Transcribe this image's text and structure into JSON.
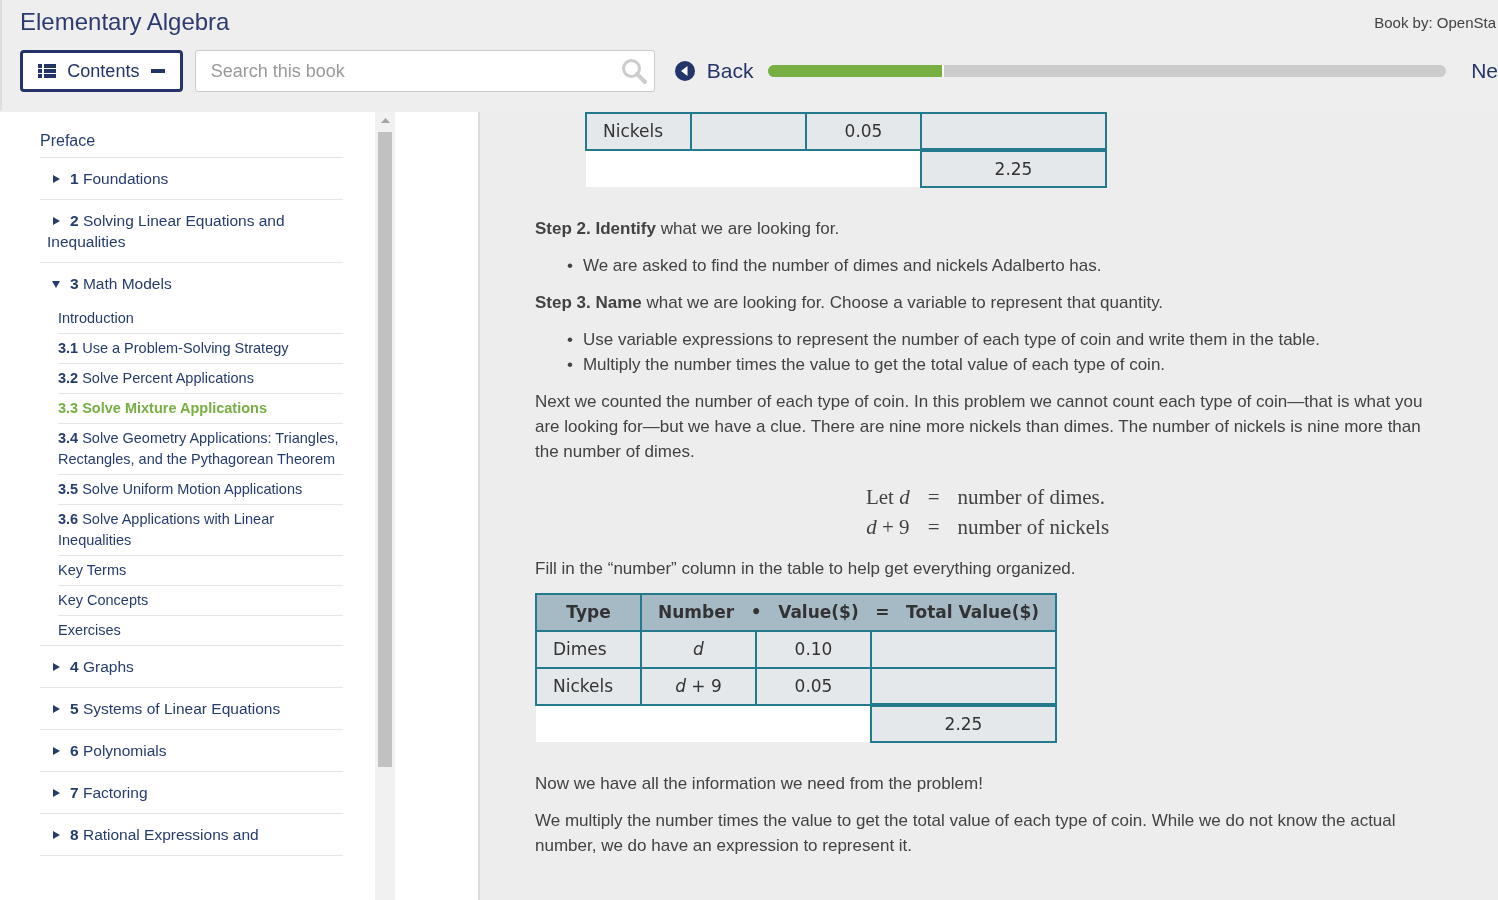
{
  "header": {
    "title": "Elementary Algebra",
    "book_by": "Book by: OpenSta",
    "contents_button": "Contents",
    "search": {
      "placeholder": "Search this book"
    },
    "back": "Back",
    "progress": {
      "level": 0.26
    },
    "next": "Ne"
  },
  "toc": [
    {
      "kind": "link",
      "title": "Preface"
    },
    {
      "kind": "chapter",
      "num": "1",
      "title": "Foundations",
      "expanded": false
    },
    {
      "kind": "chapter",
      "num": "2",
      "title": "Solving Linear Equations and Inequalities",
      "expanded": false
    },
    {
      "kind": "chapter",
      "num": "3",
      "title": "Math Models",
      "expanded": true,
      "children": [
        {
          "title": "Introduction",
          "selected": false
        },
        {
          "num": "3.1",
          "title": "Use a Problem-Solving Strategy",
          "selected": false
        },
        {
          "num": "3.2",
          "title": "Solve Percent Applications",
          "selected": false
        },
        {
          "num": "3.3",
          "title": "Solve Mixture Applications",
          "selected": true
        },
        {
          "num": "3.4",
          "title": "Solve Geometry Applications: Triangles, Rectangles, and the Pythagorean Theorem",
          "selected": false
        },
        {
          "num": "3.5",
          "title": "Solve Uniform Motion Applications",
          "selected": false
        },
        {
          "num": "3.6",
          "title": "Solve Applications with Linear Inequalities",
          "selected": false
        },
        {
          "title": "Key Terms",
          "selected": false
        },
        {
          "title": "Key Concepts",
          "selected": false
        },
        {
          "title": "Exercises",
          "selected": false
        }
      ]
    },
    {
      "kind": "chapter",
      "num": "4",
      "title": "Graphs",
      "expanded": false
    },
    {
      "kind": "chapter",
      "num": "5",
      "title": "Systems of Linear Equations",
      "expanded": false
    },
    {
      "kind": "chapter",
      "num": "6",
      "title": "Polynomials",
      "expanded": false
    },
    {
      "kind": "chapter",
      "num": "7",
      "title": "Factoring",
      "expanded": false
    },
    {
      "kind": "chapter",
      "num": "8",
      "title": "Rational Expressions and",
      "expanded": false
    }
  ],
  "content": [
    {
      "kind": "table",
      "rows": [
        [
          "Nickels",
          "",
          "0.05",
          ""
        ]
      ],
      "total": "2.25"
    },
    {
      "kind": "paragraph",
      "text": "**Step 2. Identify** what we are looking for."
    },
    {
      "kind": "bullets",
      "marker": "•",
      "items": [
        "We are asked to find the number of dimes and nickels Adalberto has."
      ]
    },
    {
      "kind": "paragraph",
      "text": "**Step 3. Name** what we are looking for. Choose a variable to represent that quantity."
    },
    {
      "kind": "bullets",
      "marker": "•",
      "items": [
        "Use variable expressions to represent the number of each type of coin and write them in the table.",
        "Multiply the number times the value to get the total value of each type of coin."
      ]
    },
    {
      "kind": "paragraph",
      "text": "Next we counted the number of each type of coin. In this problem we cannot count each type of coin—that is what you are looking for—but we have a clue. There are nine more nickels than dimes. The number of nickels is nine more than the number of dimes."
    },
    {
      "kind": "equations",
      "rows": [
        {
          "lhs": "Let *d*",
          "op": "=",
          "rhs": "number of dimes."
        },
        {
          "lhs": "*d* + 9",
          "op": "=",
          "rhs": "number of nickels"
        }
      ]
    },
    {
      "kind": "paragraph",
      "text": "Fill in the “number” column in the table to help get everything organized."
    },
    {
      "kind": "table",
      "header": [
        "Type",
        "Number",
        "•",
        "Value($)",
        "=",
        "Total Value($)"
      ],
      "rows": [
        [
          "Dimes",
          "*d*",
          "0.10",
          ""
        ],
        [
          "Nickels",
          "*d* + 9",
          "0.05",
          ""
        ]
      ],
      "total": "2.25"
    },
    {
      "kind": "paragraph",
      "text": "Now we have all the information we need from the problem!"
    },
    {
      "kind": "paragraph",
      "text": "We multiply the number times the value to get the total value of each type of coin. While we do not know the actual number, we do have an expression to represent it."
    }
  ]
}
